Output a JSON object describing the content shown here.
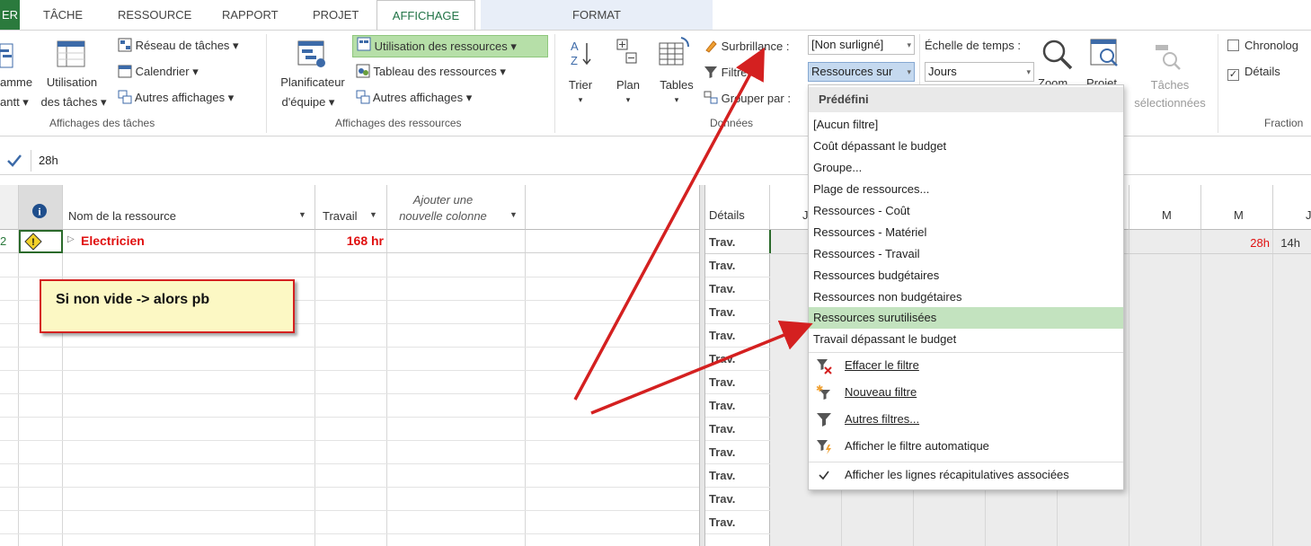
{
  "tabs": [
    {
      "label": "ER",
      "active": false
    },
    {
      "label": "TÂCHE",
      "active": false
    },
    {
      "label": "RESSOURCE",
      "active": false
    },
    {
      "label": "RAPPORT",
      "active": false
    },
    {
      "label": "PROJET",
      "active": false
    },
    {
      "label": "AFFICHAGE",
      "active": true
    },
    {
      "label": "FORMAT",
      "active": false
    }
  ],
  "ribbon": {
    "task_views": {
      "gantt_label_1": "amme",
      "gantt_label_2": "antt",
      "usage_label_1": "Utilisation",
      "usage_label_2": "des tâches",
      "network": "Réseau de tâches",
      "calendar": "Calendrier",
      "other": "Autres affichages",
      "group_label": "Affichages des tâches"
    },
    "resource_views": {
      "planner_1": "Planificateur",
      "planner_2": "d'équipe",
      "usage": "Utilisation des ressources",
      "sheet": "Tableau des ressources",
      "other": "Autres affichages",
      "group_label": "Affichages des ressources"
    },
    "data": {
      "sort": "Trier",
      "outline": "Plan",
      "tables": "Tables",
      "highlight_label": "Surbrillance :",
      "highlight_value": "[Non surligné]",
      "filter_label": "Filtrer :",
      "filter_value": "Ressources sur",
      "group_label_btn": "Grouper par :",
      "group_label": "Données"
    },
    "zoom": {
      "timescale_label": "Échelle de temps :",
      "timescale_value": "Jours",
      "zoom": "Zoom",
      "project": "Projet",
      "selected_tasks_1": "Tâches",
      "selected_tasks_2": "sélectionnées"
    },
    "split": {
      "timeline": "Chronolog",
      "details": "Détails",
      "timeline_checked": false,
      "details_checked": true,
      "group_label": "Fraction"
    }
  },
  "formula_bar": {
    "value": "28h"
  },
  "grid": {
    "headers": {
      "info": "i",
      "name": "Nom de la ressource",
      "work": "Travail",
      "add_col_1": "Ajouter une",
      "add_col_2": "nouvelle colonne"
    },
    "row": {
      "id": "2",
      "name": "Electricien",
      "work": "168 hr"
    }
  },
  "usage": {
    "details_header": "Détails",
    "day_headers": [
      "J",
      "M",
      "M",
      "J"
    ],
    "row_label": "Trav.",
    "values": [
      "h",
      "28h",
      "14h"
    ]
  },
  "callout": {
    "text": "Si non vide -> alors pb"
  },
  "filter_menu": {
    "header": "Prédéfini",
    "items": [
      "[Aucun filtre]",
      "Coût dépassant le budget",
      "Groupe...",
      "Plage de ressources...",
      "Ressources - Coût",
      "Ressources - Matériel",
      "Ressources - Travail",
      "Ressources budgétaires",
      "Ressources non budgétaires",
      "Ressources surutilisées",
      "Travail dépassant le budget"
    ],
    "highlighted_index": 9,
    "actions": [
      {
        "label": "Effacer le filtre",
        "icon": "clear-filter-icon"
      },
      {
        "label": "Nouveau filtre",
        "icon": "new-filter-icon"
      },
      {
        "label": "Autres filtres...",
        "icon": "funnel-icon"
      },
      {
        "label": "Afficher le filtre automatique",
        "icon": "autofilter-icon"
      },
      {
        "label": "Afficher les lignes récapitulatives associées",
        "icon": "check-icon"
      }
    ]
  },
  "colors": {
    "accent_green": "#217346",
    "highlight_green": "#c3e3bf",
    "overallocated_red": "#e01010",
    "arrow_red": "#d42020"
  }
}
